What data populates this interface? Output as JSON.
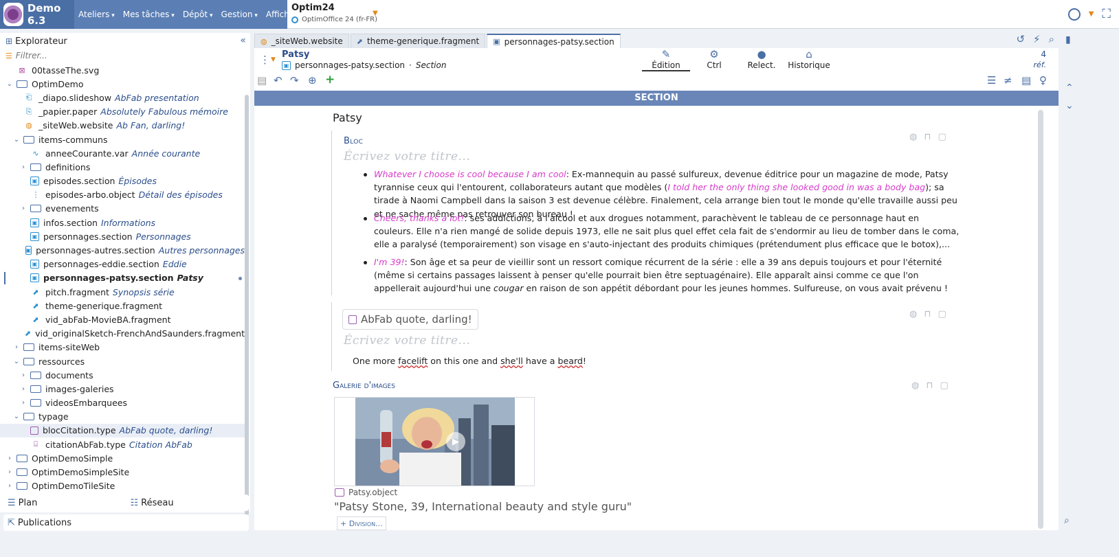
{
  "app": {
    "name": "Demo 6.3"
  },
  "menu": [
    "Ateliers",
    "Mes tâches",
    "Dépôt",
    "Gestion",
    "Affichage"
  ],
  "product": {
    "name": "Optim24",
    "version": "OptimOffice 24 (fr-FR)"
  },
  "explorer": {
    "title": "Explorateur",
    "filter_placeholder": "Filtrer...",
    "items": [
      {
        "name": "00tasseThe.svg",
        "sub": ""
      },
      {
        "name": "OptimDemo",
        "sub": ""
      },
      {
        "name": "_diapo.slideshow",
        "sub": "AbFab presentation"
      },
      {
        "name": "_papier.paper",
        "sub": "Absolutely Fabulous mémoire"
      },
      {
        "name": "_siteWeb.website",
        "sub": "Ab Fan, darling!"
      },
      {
        "name": "items-communs",
        "sub": ""
      },
      {
        "name": "anneeCourante.var",
        "sub": "Année courante"
      },
      {
        "name": "definitions",
        "sub": ""
      },
      {
        "name": "episodes.section",
        "sub": "Épisodes"
      },
      {
        "name": "episodes-arbo.object",
        "sub": "Détail des épisodes"
      },
      {
        "name": "evenements",
        "sub": ""
      },
      {
        "name": "infos.section",
        "sub": "Informations"
      },
      {
        "name": "personnages.section",
        "sub": "Personnages"
      },
      {
        "name": "personnages-autres.section",
        "sub": "Autres personnages"
      },
      {
        "name": "personnages-eddie.section",
        "sub": "Eddie"
      },
      {
        "name": "personnages-patsy.section",
        "sub": "Patsy"
      },
      {
        "name": "pitch.fragment",
        "sub": "Synopsis série"
      },
      {
        "name": "theme-generique.fragment",
        "sub": ""
      },
      {
        "name": "vid_abFab-MovieBA.fragment",
        "sub": ""
      },
      {
        "name": "vid_originalSketch-FrenchAndSaunders.fragment",
        "sub": ""
      },
      {
        "name": "items-siteWeb",
        "sub": ""
      },
      {
        "name": "ressources",
        "sub": ""
      },
      {
        "name": "documents",
        "sub": ""
      },
      {
        "name": "images-galeries",
        "sub": ""
      },
      {
        "name": "videosEmbarquees",
        "sub": ""
      },
      {
        "name": "typage",
        "sub": ""
      },
      {
        "name": "blocCitation.type",
        "sub": "AbFab quote, darling!"
      },
      {
        "name": "citationAbFab.type",
        "sub": "Citation AbFab"
      },
      {
        "name": "OptimDemoSimple",
        "sub": ""
      },
      {
        "name": "OptimDemoSimpleSite",
        "sub": ""
      },
      {
        "name": "OptimDemoTileSite",
        "sub": ""
      }
    ]
  },
  "bottom_tabs": {
    "plan": "Plan",
    "reseau": "Réseau",
    "publications": "Publications"
  },
  "editor_tabs": [
    "_siteWeb.website",
    "theme-generique.fragment",
    "personnages-patsy.section"
  ],
  "doc": {
    "title": "Patsy",
    "file": "personnages-patsy.section",
    "type": "Section",
    "sep": "·",
    "views": [
      "Édition",
      "Ctrl",
      "Relect.",
      "Historique"
    ],
    "ref_count": "4",
    "ref_label": "réf."
  },
  "section_label": "SECTION",
  "content": {
    "section_title": "Patsy",
    "bloc_label": "Bloc",
    "title_placeholder": "Écrivez votre titre...",
    "bullets": [
      {
        "quote": "Whatever I choose is cool because I am cool",
        "t1": ": Ex-mannequin au passé sulfureux, devenue éditrice pour un magazine de mode, Patsy tyrannise ceux qui l'entourent, collaborateurs autant que modèles (",
        "quote2": "I told her the only thing she looked good in was a body bag",
        "t2": "); sa tirade à Naomi Campbell dans la saison 3 est devenue célèbre. Finalement, cela arrange bien tout le monde qu'elle travaille aussi peu et ne sache même pas retrouver son bureau !"
      },
      {
        "quote": "Cheers, thanks a lot!",
        "t1": ": ses addictions, à l'alcool et aux drogues notamment, parachèvent le tableau de ce personnage haut en couleurs. Elle n'a rien mangé de solide depuis 1973, elle ne sait plus quel effet cela fait de s'endormir au lieu de tomber dans le coma, elle a paralysé (temporairement) son visage en s'auto-injectant des produits chimiques (prétendument plus efficace que le botox),..."
      },
      {
        "quote": "I'm 39!",
        "t1": ": Son âge et sa peur de vieillir sont un ressort comique récurrent de la série : elle a 39 ans depuis toujours et pour l'éternité (même si certains passages laissent à penser qu'elle pourrait bien être septuagénaire). Elle apparaît ainsi comme ce que l'on appellerait aujourd'hui une ",
        "em": "cougar",
        "t2": " en raison de son appétit débordant pour les jeunes hommes. Sulfureuse, on vous avait prévenu !"
      }
    ],
    "quote_card": "AbFab quote, darling!",
    "quote_text": {
      "a": "One more ",
      "b": "facelift",
      "c": " on this one and ",
      "d": "she'll",
      "e": " have a ",
      "f": "beard",
      "g": "!"
    },
    "gallery_label": "Galerie d'images",
    "gallery_file": "Patsy.object",
    "gallery_caption": "\"Patsy Stone, 39, International beauty and style guru\"",
    "add_division": "+ Division..."
  },
  "colors": {
    "brand": "#4a6fa5",
    "menu": "#5b7fb4",
    "section_bar": "#6a86b8",
    "quote": "#d63cc9",
    "add": "#2e9e3a"
  }
}
